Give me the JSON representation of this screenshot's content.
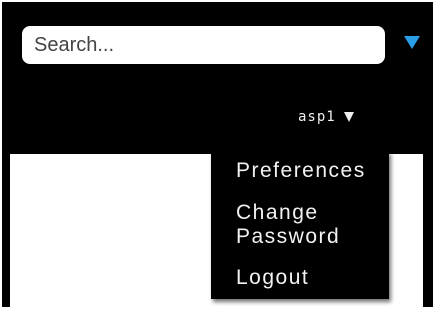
{
  "header": {
    "search": {
      "placeholder": "Search...",
      "value": "",
      "toggle_icon": "triangle-down-icon",
      "toggle_color": "#2a9ee6"
    },
    "user": {
      "name": "asp1",
      "caret_icon": "caret-down-icon"
    }
  },
  "user_dropdown": {
    "items": [
      {
        "label": "Preferences"
      },
      {
        "label_line1": "Change",
        "label_line2": "Password"
      },
      {
        "label": "Logout"
      }
    ]
  },
  "colors": {
    "header_background": "#000000",
    "menu_background": "#000000",
    "menu_text": "#f2f2f2",
    "content_background": "#ffffff",
    "accent": "#2a9ee6"
  }
}
